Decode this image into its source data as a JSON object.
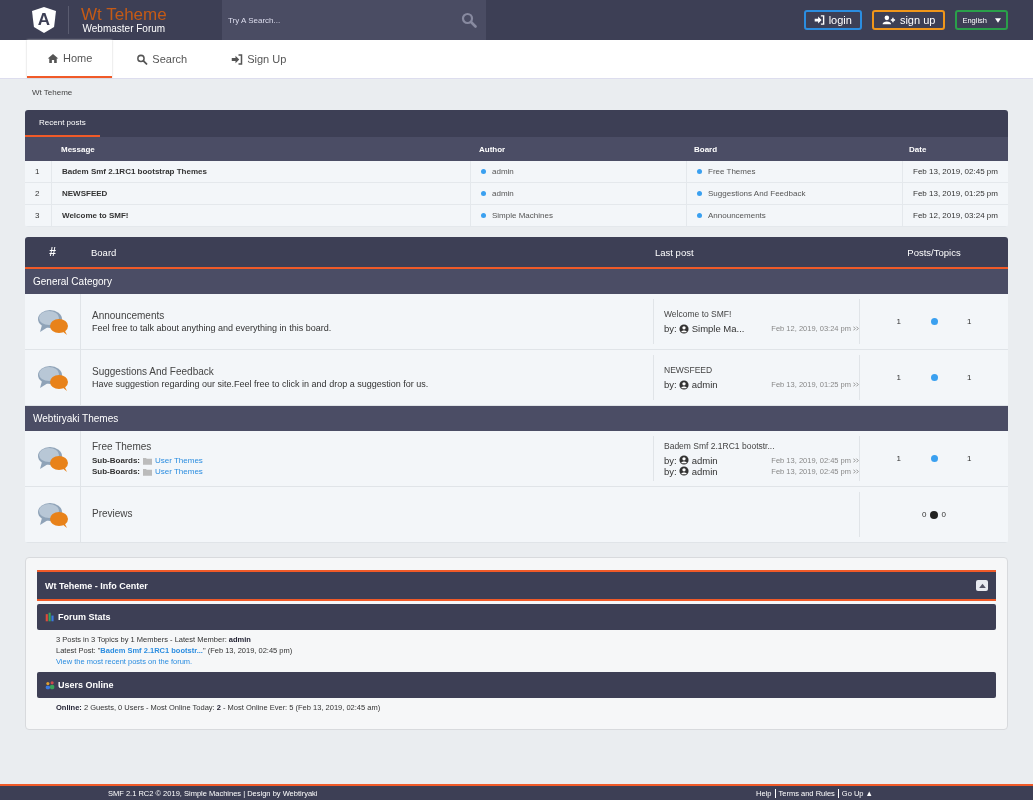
{
  "header": {
    "logo_letter": "A",
    "site_title": "Wt Teheme",
    "site_subtitle": "Webmaster Forum",
    "search": {
      "placeholder": "Try A Search..."
    },
    "login": "login",
    "signup": "sign up",
    "language": "English"
  },
  "nav": [
    {
      "label": "Home",
      "selected": true
    },
    {
      "label": "Search",
      "selected": false
    },
    {
      "label": "Sign Up",
      "selected": false
    }
  ],
  "breadcrumb": "Wt Teheme",
  "recent_posts": {
    "tab": "Recent posts",
    "columns": [
      "Message",
      "Author",
      "Board",
      "Date"
    ],
    "rows": [
      {
        "number": "1",
        "message": "Badem Smf 2.1RC1 bootstrap Themes",
        "author": "admin",
        "board": "Free Themes",
        "date": "Feb 13, 2019, 02:45 pm"
      },
      {
        "number": "2",
        "message": "NEWSFEED",
        "author": "admin",
        "board": "Suggestions And Feedback",
        "date": "Feb 13, 2019, 01:25 pm"
      },
      {
        "number": "3",
        "message": "Welcome to SMF!",
        "author": "Simple Machines",
        "board": "Announcements",
        "date": "Feb 12, 2019, 03:24 pm"
      }
    ]
  },
  "board_index": {
    "columns": [
      "#",
      "Board",
      "Last post",
      "Posts/Topics"
    ],
    "categories": [
      {
        "name": "General Category",
        "boards": [
          {
            "name": "Announcements",
            "description": "Feel free to talk about anything and everything in this board.",
            "last_post": {
              "subject": "Welcome to SMF!",
              "by": [
                {
                  "label": "by:",
                  "user": "Simple Ma...",
                  "date": "Feb 12, 2019, 03:24 pm"
                }
              ]
            },
            "posts": "1",
            "topics": "1",
            "new": true
          },
          {
            "name": "Suggestions And Feedback",
            "description": "Have  suggestion regarding our site.Feel free to click in and drop a suggestion for us.",
            "last_post": {
              "subject": "NEWSFEED",
              "by": [
                {
                  "label": "by:",
                  "user": "admin",
                  "date": "Feb 13, 2019, 01:25 pm"
                }
              ]
            },
            "posts": "1",
            "topics": "1",
            "new": true
          }
        ]
      },
      {
        "name": "Webtiryaki Themes",
        "boards": [
          {
            "name": "Free Themes",
            "sub_boards": [
              {
                "label": "Sub-Boards:",
                "name": "User Themes"
              },
              {
                "label": "Sub-Boards:",
                "name": "User Themes"
              }
            ],
            "last_post": {
              "subject": "Badem Smf 2.1RC1 bootstr...",
              "by": [
                {
                  "label": "by:",
                  "user": "admin",
                  "date": "Feb 13, 2019, 02:45 pm"
                },
                {
                  "label": "by:",
                  "user": "admin",
                  "date": "Feb 13, 2019, 02:45 pm"
                }
              ]
            },
            "posts": "1",
            "topics": "1",
            "new": true
          },
          {
            "name": "Previews",
            "posts": "0",
            "topics": "0",
            "new": false
          }
        ]
      }
    ]
  },
  "info_center": {
    "title": "Wt Teheme - Info Center",
    "sections": [
      {
        "title": "Forum Stats",
        "lines": [
          "3 Posts in 3 Topics by 1 Members - Latest Member: **admin**",
          "Latest Post: \"**Badem Smf 2.1RC1 bootstr...**\" (Feb 13, 2019, 02:45 pm)"
        ],
        "link": "View the most recent posts on the forum."
      },
      {
        "title": "Users Online",
        "lines": [
          "**Online:** 2 Guests, 0 Users  - Most Online Today: **2** -  Most Online Ever: 5 (Feb 13, 2019, 02:45 am)"
        ]
      }
    ]
  },
  "footer": {
    "left": "SMF 2.1 RC2 © 2019, Simple Machines | Design by Webtiryaki",
    "links": [
      "Help",
      "Terms and Rules",
      "Go Up ▲"
    ]
  }
}
